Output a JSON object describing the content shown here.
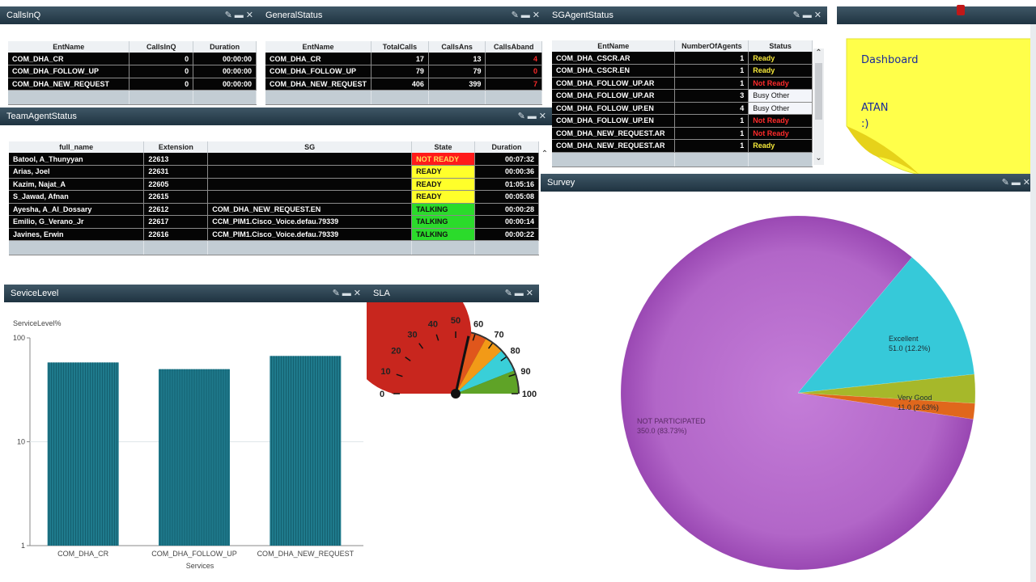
{
  "callsinq": {
    "title": "CallsInQ",
    "columns": [
      "EntName",
      "CallsInQ",
      "Duration"
    ],
    "rows": [
      [
        "COM_DHA_CR",
        "0",
        "00:00:00"
      ],
      [
        "COM_DHA_FOLLOW_UP",
        "0",
        "00:00:00"
      ],
      [
        "COM_DHA_NEW_REQUEST",
        "0",
        "00:00:00"
      ]
    ]
  },
  "general": {
    "title": "GeneralStatus",
    "columns": [
      "EntName",
      "TotalCalls",
      "CallsAns",
      "CallsAband"
    ],
    "rows": [
      [
        "COM_DHA_CR",
        "17",
        "13",
        "4"
      ],
      [
        "COM_DHA_FOLLOW_UP",
        "79",
        "79",
        "0"
      ],
      [
        "COM_DHA_NEW_REQUEST",
        "406",
        "399",
        "7"
      ]
    ]
  },
  "sgagent": {
    "title": "SGAgentStatus",
    "columns": [
      "EntName",
      "NumberOfAgents",
      "Status"
    ],
    "rows": [
      [
        "COM_DHA_CSCR.AR",
        "1",
        "Ready"
      ],
      [
        "COM_DHA_CSCR.EN",
        "1",
        "Ready"
      ],
      [
        "COM_DHA_FOLLOW_UP.AR",
        "1",
        "Not Ready"
      ],
      [
        "COM_DHA_FOLLOW_UP.AR",
        "3",
        "Busy Other"
      ],
      [
        "COM_DHA_FOLLOW_UP.EN",
        "4",
        "Busy Other"
      ],
      [
        "COM_DHA_FOLLOW_UP.EN",
        "1",
        "Not Ready"
      ],
      [
        "COM_DHA_NEW_REQUEST.AR",
        "1",
        "Not Ready"
      ],
      [
        "COM_DHA_NEW_REQUEST.AR",
        "1",
        "Ready"
      ]
    ]
  },
  "team": {
    "title": "TeamAgentStatus",
    "columns": [
      "full_name",
      "Extension",
      "SG",
      "State",
      "Duration"
    ],
    "rows": [
      [
        "Batool, A_Thunyyan",
        "22613",
        "",
        "NOT READY",
        "00:07:32"
      ],
      [
        "Arias, Joel",
        "22631",
        "",
        "READY",
        "00:00:36"
      ],
      [
        "Kazim, Najat_A",
        "22605",
        "",
        "READY",
        "01:05:16"
      ],
      [
        "S_Jawad, Afnan",
        "22615",
        "",
        "READY",
        "00:05:08"
      ],
      [
        "Ayesha, A_Al_Dossary",
        "22612",
        "COM_DHA_NEW_REQUEST.EN",
        "TALKING",
        "00:00:28"
      ],
      [
        "Emilio, G_Verano_Jr",
        "22617",
        "CCM_PIM1.Cisco_Voice.defau.79339",
        "TALKING",
        "00:00:14"
      ],
      [
        "Javines, Erwin",
        "22616",
        "CCM_PIM1.Cisco_Voice.defau.79339",
        "TALKING",
        "00:00:22"
      ]
    ]
  },
  "note": {
    "line1": "Dashboard",
    "line2": "ATAN",
    "line3": ":)"
  },
  "servicelevel": {
    "title": "SeviceLevel"
  },
  "sla": {
    "title": "SLA"
  },
  "survey": {
    "title": "Survey"
  },
  "colors": {
    "bar": "#1f7a8c",
    "titlebar": "#2c4350",
    "pie_main": "#b469c9",
    "pie_excellent": "#36c9d9",
    "pie_verygood": "#a6b82a",
    "pie_orange": "#e0671c"
  },
  "chart_data": [
    {
      "type": "bar",
      "title": "",
      "ylabel": "ServiceLevel%",
      "xlabel": "Services",
      "yscale": "log",
      "ylim": [
        1,
        100
      ],
      "yticks": [
        "100",
        "10",
        "1"
      ],
      "categories": [
        "COM_DHA_CR",
        "COM_DHA_FOLLOW_UP",
        "COM_DHA_NEW_REQUEST"
      ],
      "values": [
        58,
        50,
        67
      ]
    },
    {
      "type": "gauge",
      "ticks": [
        "0",
        "10",
        "20",
        "30",
        "40",
        "50",
        "60",
        "70",
        "80",
        "90",
        "100"
      ],
      "range": [
        0,
        100
      ],
      "value": 57
    },
    {
      "type": "pie",
      "slices": [
        {
          "label": "NOT PARTICIPATED",
          "value_text": "350.0 (83.73%)",
          "value": 350.0
        },
        {
          "label": "Excellent",
          "value_text": "51.0 (12.2%)",
          "value": 51.0
        },
        {
          "label": "Very Good",
          "value_text": "11.0 (2.63%)",
          "value": 11.0
        },
        {
          "label": "",
          "value_text": "",
          "value": 6.0
        }
      ]
    }
  ]
}
